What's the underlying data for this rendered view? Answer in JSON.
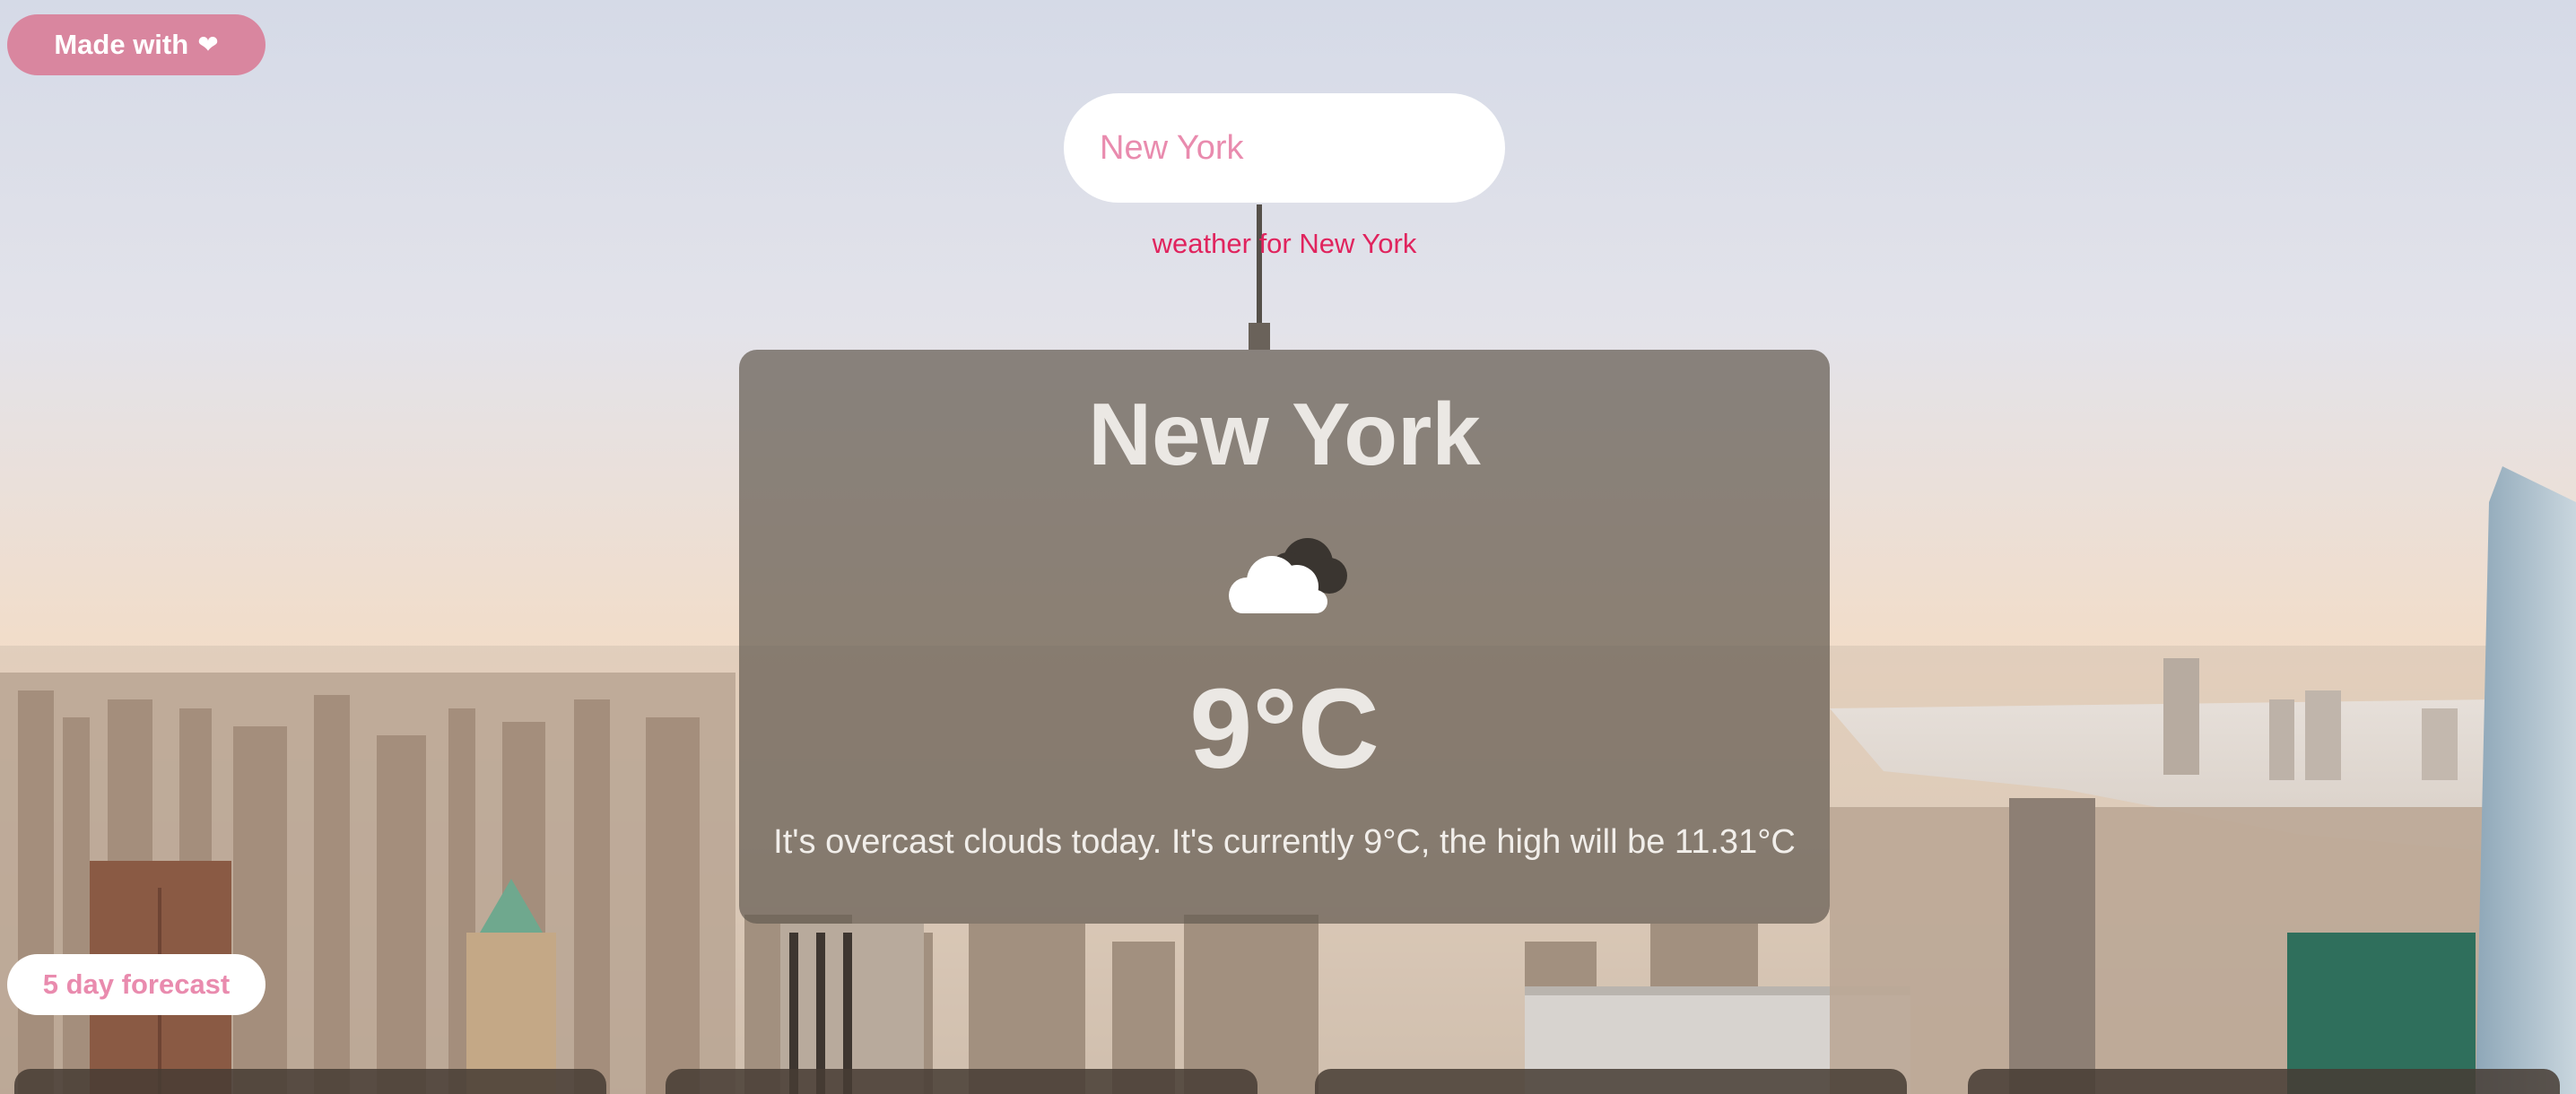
{
  "badge": {
    "label": "Made with",
    "heart": "❤"
  },
  "search": {
    "value": "New York",
    "placeholder": "",
    "caption": "weather for New York"
  },
  "weather": {
    "city": "New York",
    "icon": "cloud-icon",
    "temperature": "9°C",
    "description": "It's overcast clouds today. It's currently 9°C, the high will be 11.31°C"
  },
  "forecast": {
    "button_label": "5 day forecast",
    "cards": [
      {
        "id": "day-1"
      },
      {
        "id": "day-2"
      },
      {
        "id": "day-3"
      },
      {
        "id": "day-4"
      }
    ]
  },
  "colors": {
    "accent_pink": "#d9869f",
    "caption_red": "#e0245e",
    "input_text_pink": "#e98bae",
    "card_bg": "#645c52"
  }
}
